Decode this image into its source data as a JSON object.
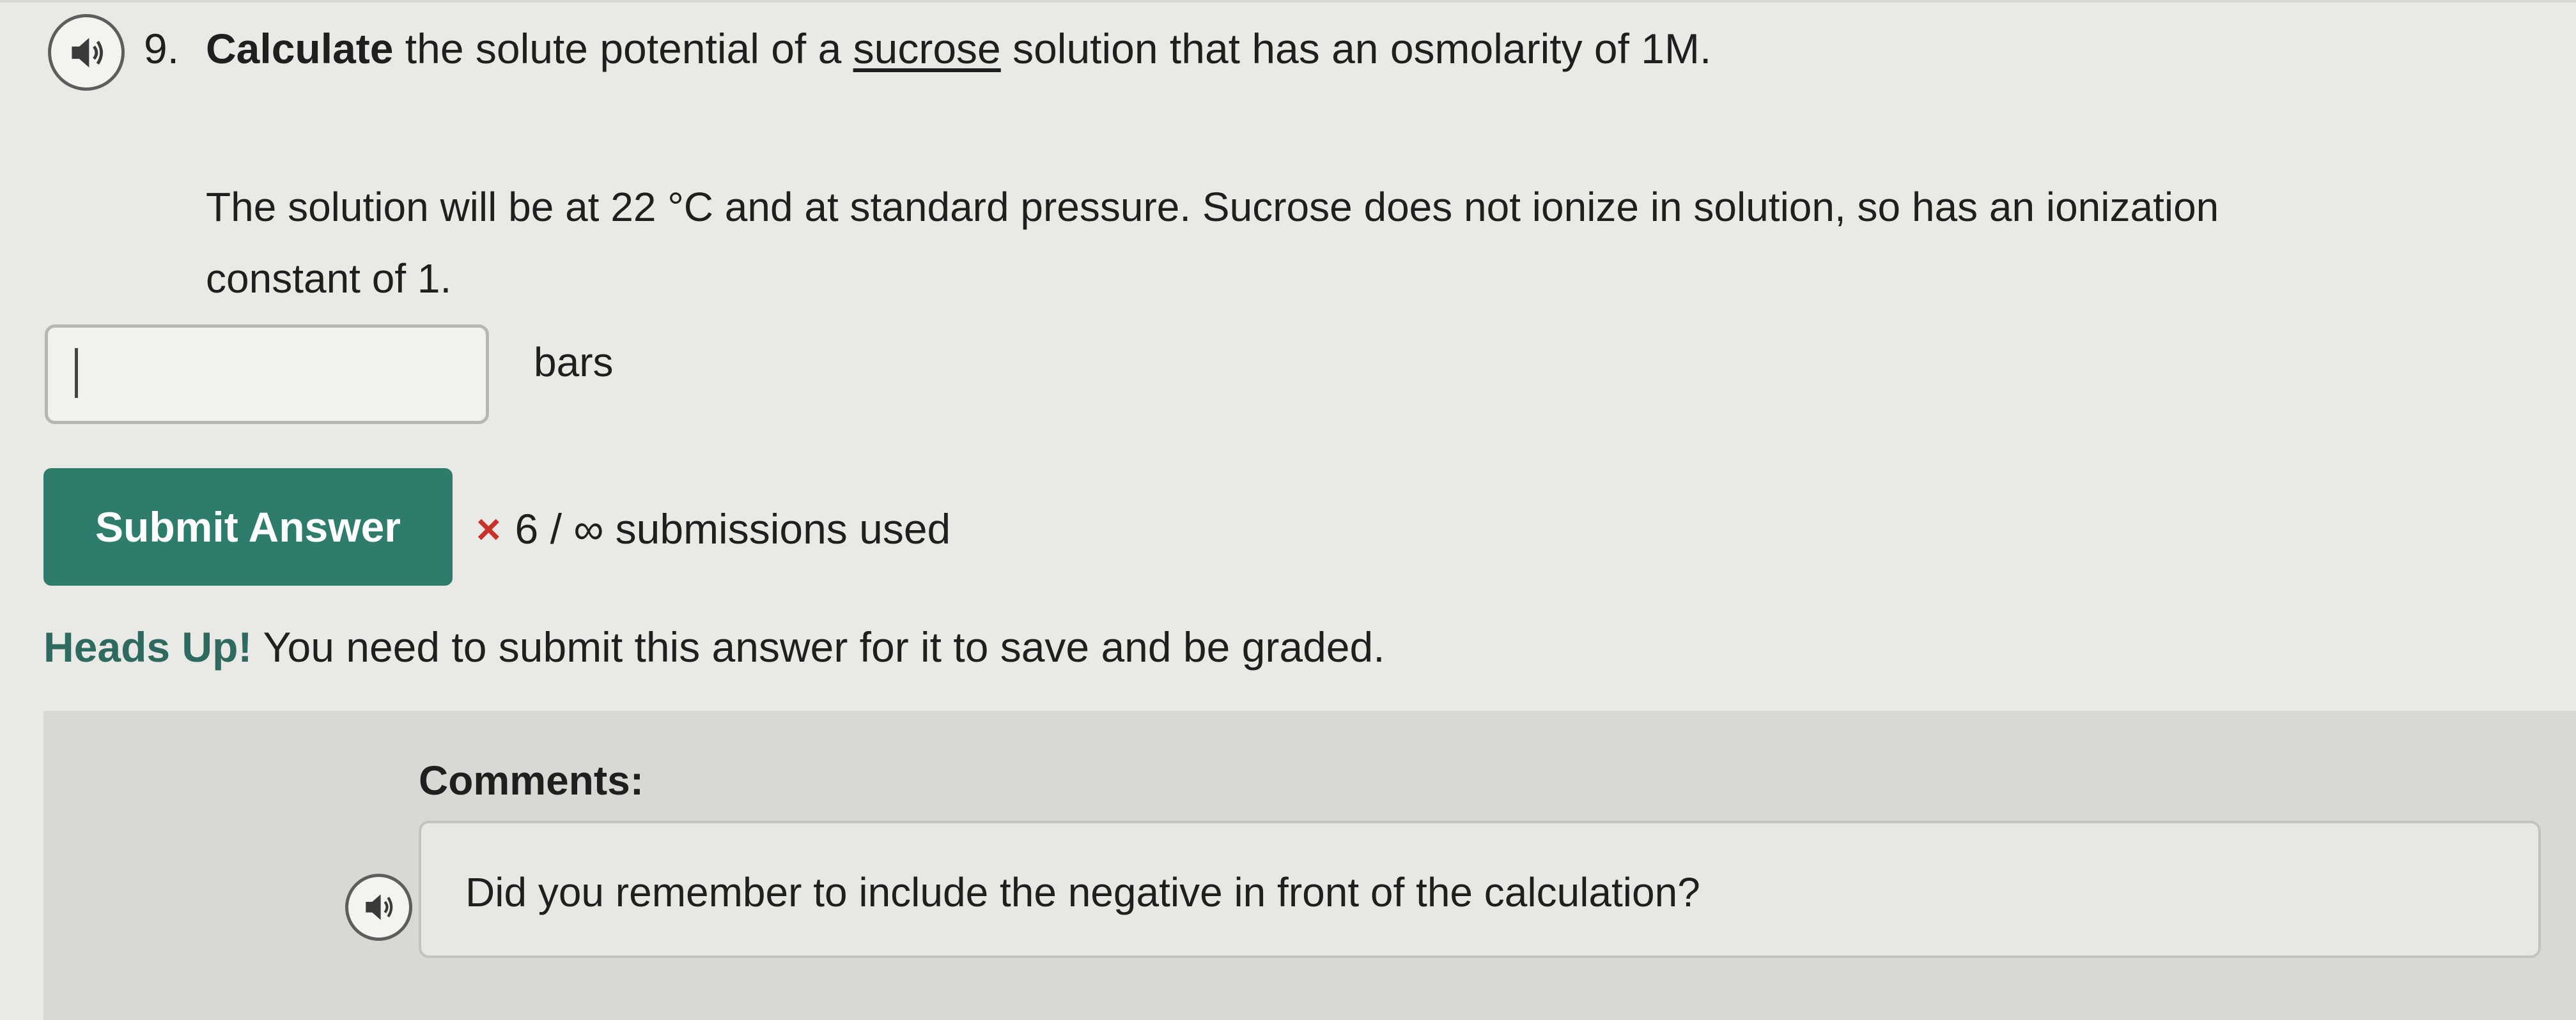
{
  "question": {
    "number": "9.",
    "verb": "Calculate",
    "text_before": " the solute potential of a ",
    "underlined": "sucrose",
    "text_after": " solution that has an osmolarity of 1M.",
    "detail": "The solution will be at 22 °C and at standard pressure. Sucrose does not ionize in solution, so has an ionization constant of 1."
  },
  "answer": {
    "value": "",
    "placeholder": "",
    "unit": "bars"
  },
  "submit": {
    "label": "Submit Answer"
  },
  "status": {
    "mark": "×",
    "text": "6 / ∞ submissions used"
  },
  "headsup": {
    "lead": "Heads Up!",
    "text": " You need to submit this answer for it to save and be graded."
  },
  "comments": {
    "label": "Comments:",
    "text": "Did you remember to include the negative in front of the calculation?"
  },
  "icons": {
    "audio": "speaker-icon"
  }
}
